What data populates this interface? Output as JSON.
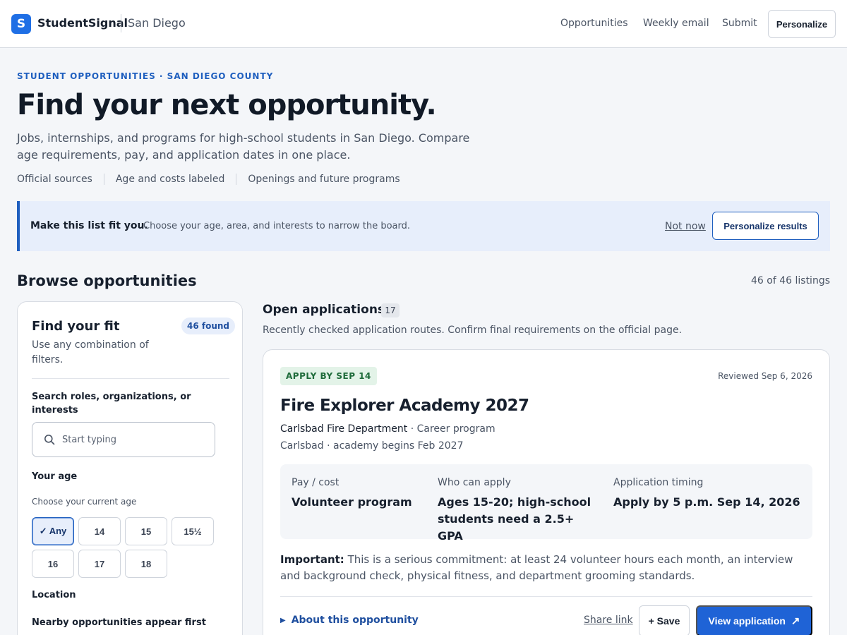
{
  "header": {
    "logo_letter": "S",
    "brand": "StudentSignal",
    "city": "San Diego",
    "nav": [
      "Opportunities",
      "Weekly email",
      "Submit"
    ],
    "personalize_label": "Personalize"
  },
  "hero": {
    "eyebrow": "STUDENT OPPORTUNITIES · SAN DIEGO COUNTY",
    "title": "Find your next opportunity.",
    "subtitle": "Jobs, internships, and programs for high-school students in San Diego. Compare age requirements, pay, and application dates in one place.",
    "tags": [
      "Official sources",
      "Age and costs labeled",
      "Openings and future programs"
    ]
  },
  "banner": {
    "strong": "Make this list fit you.",
    "text": "Choose your age, area, and interests to narrow the board.",
    "not_now": "Not now",
    "button": "Personalize results"
  },
  "browse": {
    "title": "Browse opportunities",
    "count": "46 of 46 listings"
  },
  "filters": {
    "title": "Find your fit",
    "found": "46 found",
    "subtitle": "Use any combination of filters.",
    "search_label": "Search roles, organizations, or interests",
    "search_placeholder": "Start typing",
    "age_label": "Your age",
    "age_help": "Choose your current age",
    "ages": [
      "✓ Any",
      "14",
      "15",
      "15½",
      "16",
      "17",
      "18"
    ],
    "selected_age": "Any",
    "location_label": "Location",
    "nearby_label": "Nearby opportunities appear first"
  },
  "listings": {
    "section_title": "Open applications",
    "section_count": "17",
    "section_sub": "Recently checked application routes. Confirm final requirements on the official page.",
    "card": {
      "deadline": "APPLY BY SEP 14",
      "reviewed": "Reviewed Sep 6, 2026",
      "title": "Fire Explorer Academy 2027",
      "org": "Carlsbad Fire Department",
      "category": " · Career program",
      "location": "Carlsbad · academy begins Feb 2027",
      "facts": {
        "pay_label": "Pay / cost",
        "pay_value": "Volunteer program",
        "who_label": "Who can apply",
        "who_value": "Ages 15-20; high-school students need a 2.5+ GPA",
        "timing_label": "Application timing",
        "timing_value": "Apply by 5 p.m. Sep 14, 2026"
      },
      "important_label": "Important:",
      "important_text": " This is a serious commitment: at least 24 volunteer hours each month, an interview and background check, physical fitness, and department grooming standards.",
      "about": "About this opportunity",
      "share": "Share link",
      "save": "+ Save",
      "view": "View application",
      "view_arrow": "↗"
    }
  },
  "colors": {
    "accent": "#1f63d6",
    "badge_green_bg": "#e3f3e8",
    "badge_green_text": "#1e6b3a",
    "banner_bg": "#e7eefb"
  },
  "icons": {
    "search": "search-icon",
    "caret": "caret-right-icon",
    "external": "external-link-icon"
  }
}
